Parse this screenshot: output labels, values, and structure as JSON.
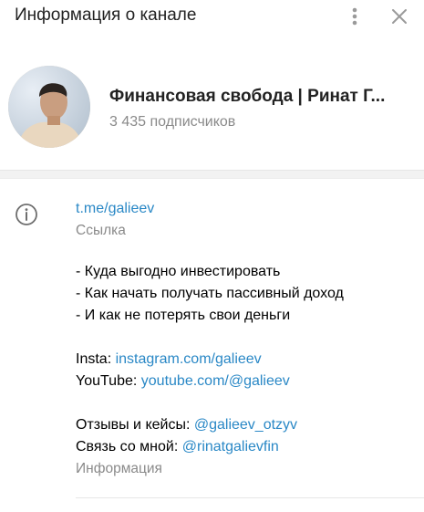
{
  "header": {
    "title": "Информация о канале"
  },
  "channel": {
    "name": "Финансовая свобода | Ринат Г...",
    "subscribers": "3 435 подписчиков"
  },
  "info": {
    "link": "t.me/galieev",
    "link_caption": "Ссылка",
    "description": [
      "- Куда выгодно инвестировать",
      "- Как начать получать пассивный доход",
      "- И как не потерять свои деньги"
    ],
    "insta_label": "Insta:",
    "insta_link": "instagram.com/galieev",
    "youtube_label": "YouTube:",
    "youtube_link": "youtube.com/@galieev",
    "reviews_label": "Отзывы и кейсы:",
    "reviews_link": "@galieev_otzyv",
    "contact_label": "Связь со мной:",
    "contact_link": "@rinatgalievfin",
    "info_caption": "Информация"
  },
  "colors": {
    "link": "#2a88c6",
    "caption": "#8a8a8a"
  },
  "icons": {
    "more": "more-vertical-icon",
    "close": "close-icon",
    "info": "info-icon"
  }
}
